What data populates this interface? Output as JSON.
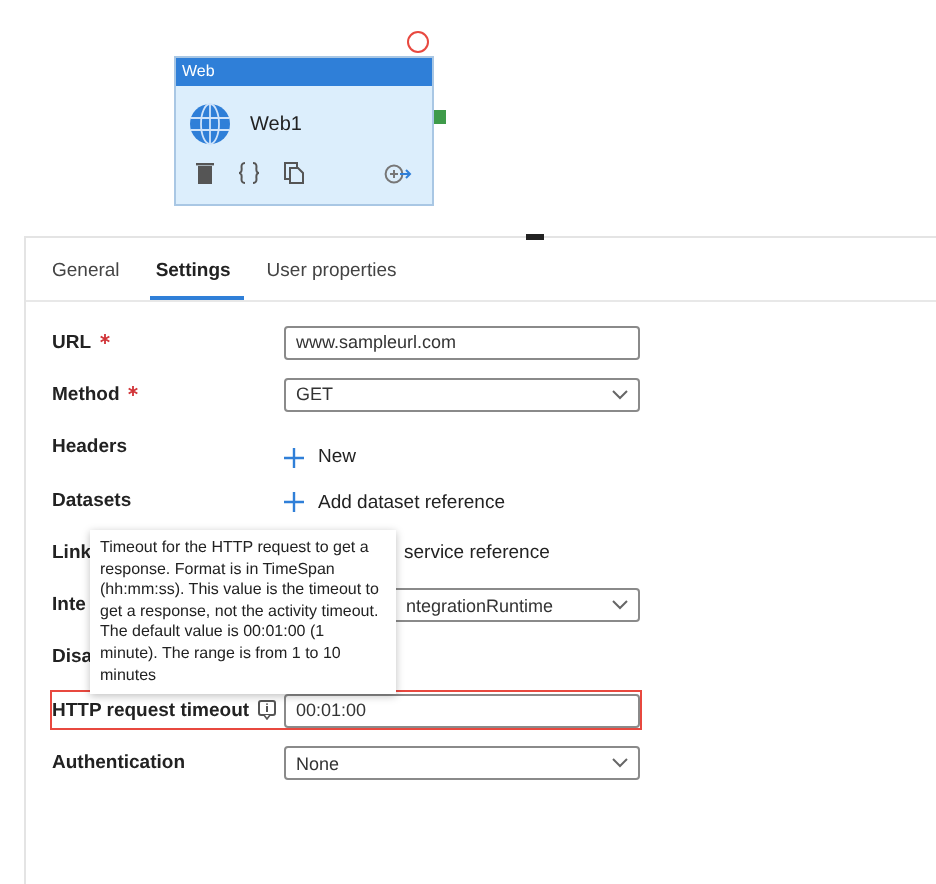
{
  "activity": {
    "type": "Web",
    "name": "Web1"
  },
  "tabs": [
    {
      "label": "General",
      "selected": false
    },
    {
      "label": "Settings",
      "selected": true
    },
    {
      "label": "User properties",
      "selected": false
    }
  ],
  "fields": [
    {
      "label": "URL",
      "required": true,
      "kind": "input",
      "value": "www.sampleurl.com",
      "info": false,
      "highlighted": false
    },
    {
      "label": "Method",
      "required": true,
      "kind": "select",
      "value": "GET",
      "info": false,
      "highlighted": false
    },
    {
      "label": "Headers",
      "required": false,
      "kind": "add",
      "value": "New",
      "info": false,
      "highlighted": false
    },
    {
      "label": "Datasets",
      "required": false,
      "kind": "add",
      "value": "Add dataset reference",
      "info": false,
      "highlighted": false
    },
    {
      "label": "Link",
      "required": false,
      "kind": "text",
      "value": "service reference",
      "info": false,
      "highlighted": false
    },
    {
      "label": "Inte",
      "required": false,
      "kind": "covered-select",
      "value": "ntegrationRuntime",
      "info": false,
      "highlighted": false
    },
    {
      "label": "Disa",
      "required": false,
      "kind": "none",
      "info": false,
      "highlighted": false
    },
    {
      "label": "HTTP request timeout",
      "required": false,
      "kind": "input",
      "value": "00:01:00",
      "info": true,
      "highlighted": true
    },
    {
      "label": "Authentication",
      "required": false,
      "kind": "select",
      "value": "None",
      "info": false,
      "highlighted": false
    }
  ],
  "tooltip": "Timeout for the HTTP request to get a response. Format is in TimeSpan (hh:mm:ss). This value is the timeout to get a response, not the activity timeout. The default value is 00:01:00 (1 minute). The range is from 1 to 10 minutes"
}
